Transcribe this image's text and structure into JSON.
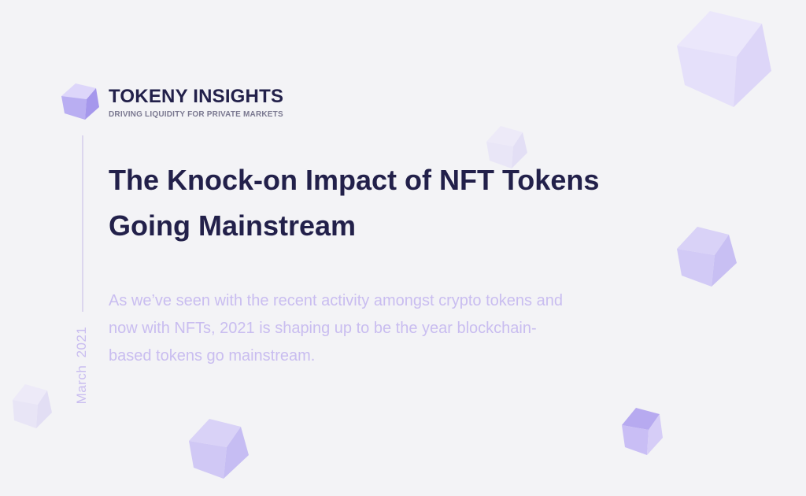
{
  "brand": {
    "title": "TOKENY INSIGHTS",
    "tagline": "DRIVING LIQUIDITY FOR PRIVATE MARKETS",
    "logo_icon": "cube-logo-icon"
  },
  "article": {
    "date": "March 2021",
    "headline": "The Knock-on Impact of NFT Tokens Going Mainstream",
    "excerpt": "As we’ve seen with the recent activity amongst crypto tokens and now with NFTs, 2021 is shaping up to be the year blockchain-based tokens go mainstream."
  },
  "colors": {
    "background": "#f3f3f6",
    "heading": "#22204a",
    "accent_purple": "#a99cf0",
    "muted_lavender": "#c9bdf0",
    "tagline_gray": "#7a7890"
  },
  "decorations": {
    "icon": "cube-icon"
  }
}
